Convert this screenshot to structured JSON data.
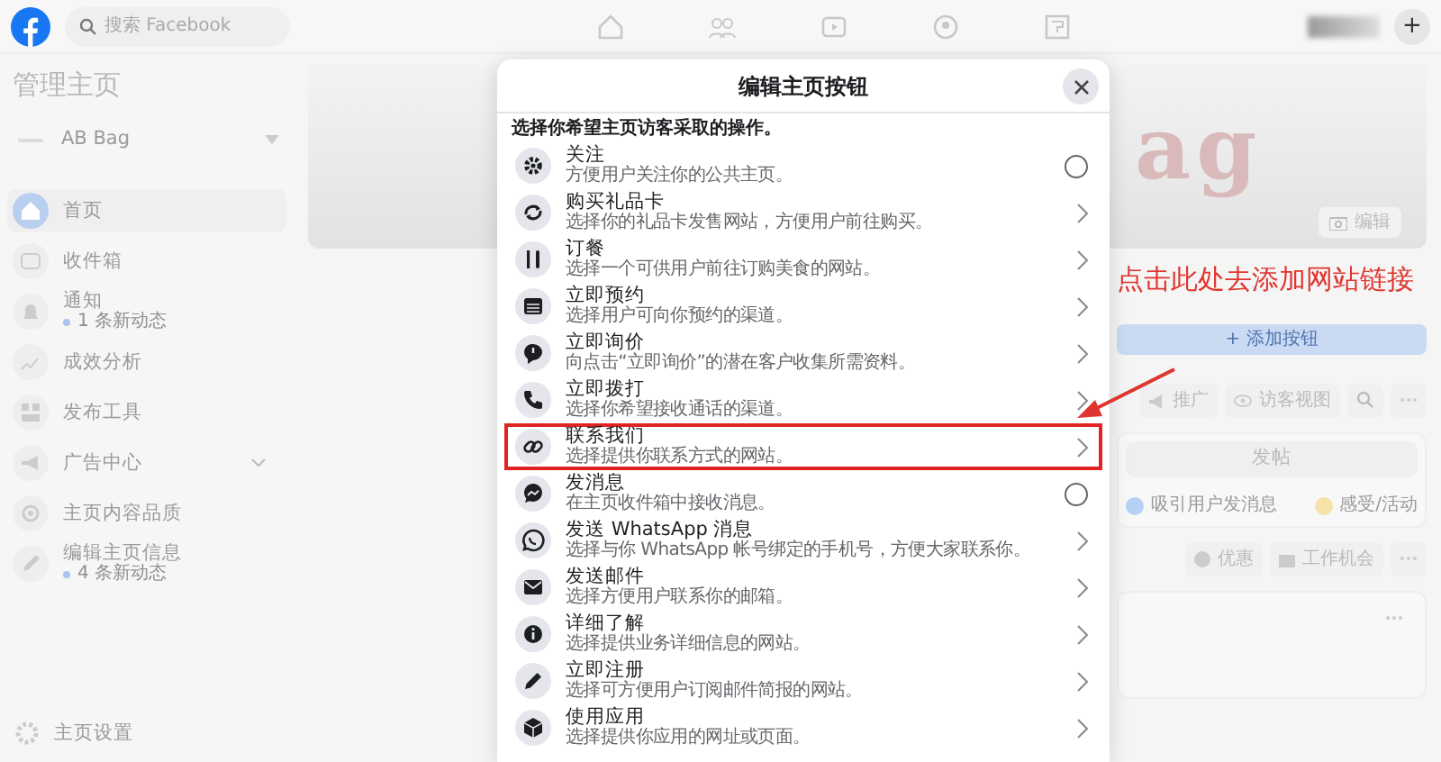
{
  "topbar": {
    "search": {
      "placeholder": "搜索 Facebook"
    },
    "create_button": "+"
  },
  "sidebar": {
    "title": "管理主页",
    "page_selector": "AB Bag",
    "items": [
      {
        "label": "首页",
        "selected": true
      },
      {
        "label": "收件箱",
        "selected": false
      },
      {
        "label": "通知",
        "note": "1 条新动态",
        "selected": false
      },
      {
        "label": "成效分析",
        "selected": false
      },
      {
        "label": "发布工具",
        "selected": false
      },
      {
        "label": "广告中心",
        "expandable": true,
        "selected": false
      },
      {
        "label": "主页内容品质",
        "selected": false
      },
      {
        "label": "编辑主页信息",
        "note": "4 条新动态",
        "selected": false
      }
    ],
    "settings": "主页设置"
  },
  "cover": {
    "name_fragment": "ag",
    "edit_button": "编辑"
  },
  "annotation": {
    "text": "点击此处去添加网站链接"
  },
  "actions": {
    "add_button": "+ 添加按钮",
    "toolbar": [
      "推广",
      "访客视图"
    ]
  },
  "composer": {
    "post_button": "发帖",
    "options": [
      "吸引用户发消息",
      "感受/活动"
    ]
  },
  "post_types": [
    "优惠",
    "工作机会"
  ],
  "dialog": {
    "title": "编辑主页按钮",
    "prompt": "选择你希望主页访客采取的操作。",
    "options": [
      {
        "title": "关注",
        "description": "方便用户关注你的公共主页。",
        "kind": "radio",
        "selected": false,
        "highlighted": false
      },
      {
        "title": "购买礼品卡",
        "description": "选择你的礼品卡发售网站，方便用户前往购买。",
        "kind": "link",
        "highlighted": false
      },
      {
        "title": "订餐",
        "description": "选择一个可供用户前往订购美食的网站。",
        "kind": "link",
        "highlighted": false
      },
      {
        "title": "立即预约",
        "description": "选择用户可向你预约的渠道。",
        "kind": "link",
        "highlighted": false
      },
      {
        "title": "立即询价",
        "description": "向点击“立即询价”的潜在客户收集所需资料。",
        "kind": "link",
        "highlighted": false
      },
      {
        "title": "立即拨打",
        "description": "选择你希望接收通话的渠道。",
        "kind": "link",
        "highlighted": false
      },
      {
        "title": "联系我们",
        "description": "选择提供你联系方式的网站。",
        "kind": "link",
        "highlighted": true
      },
      {
        "title": "发消息",
        "description": "在主页收件箱中接收消息。",
        "kind": "radio",
        "selected": false,
        "highlighted": false
      },
      {
        "title": "发送 WhatsApp 消息",
        "description": "选择与你 WhatsApp 帐号绑定的手机号，方便大家联系你。",
        "kind": "link",
        "highlighted": false
      },
      {
        "title": "发送邮件",
        "description": "选择方便用户联系你的邮箱。",
        "kind": "link",
        "highlighted": false
      },
      {
        "title": "详细了解",
        "description": "选择提供业务详细信息的网站。",
        "kind": "link",
        "highlighted": false
      },
      {
        "title": "立即注册",
        "description": "选择可方便用户订阅邮件简报的网站。",
        "kind": "link",
        "highlighted": false
      },
      {
        "title": "使用应用",
        "description": "选择提供你应用的网址或页面。",
        "kind": "link",
        "highlighted": false
      }
    ]
  }
}
